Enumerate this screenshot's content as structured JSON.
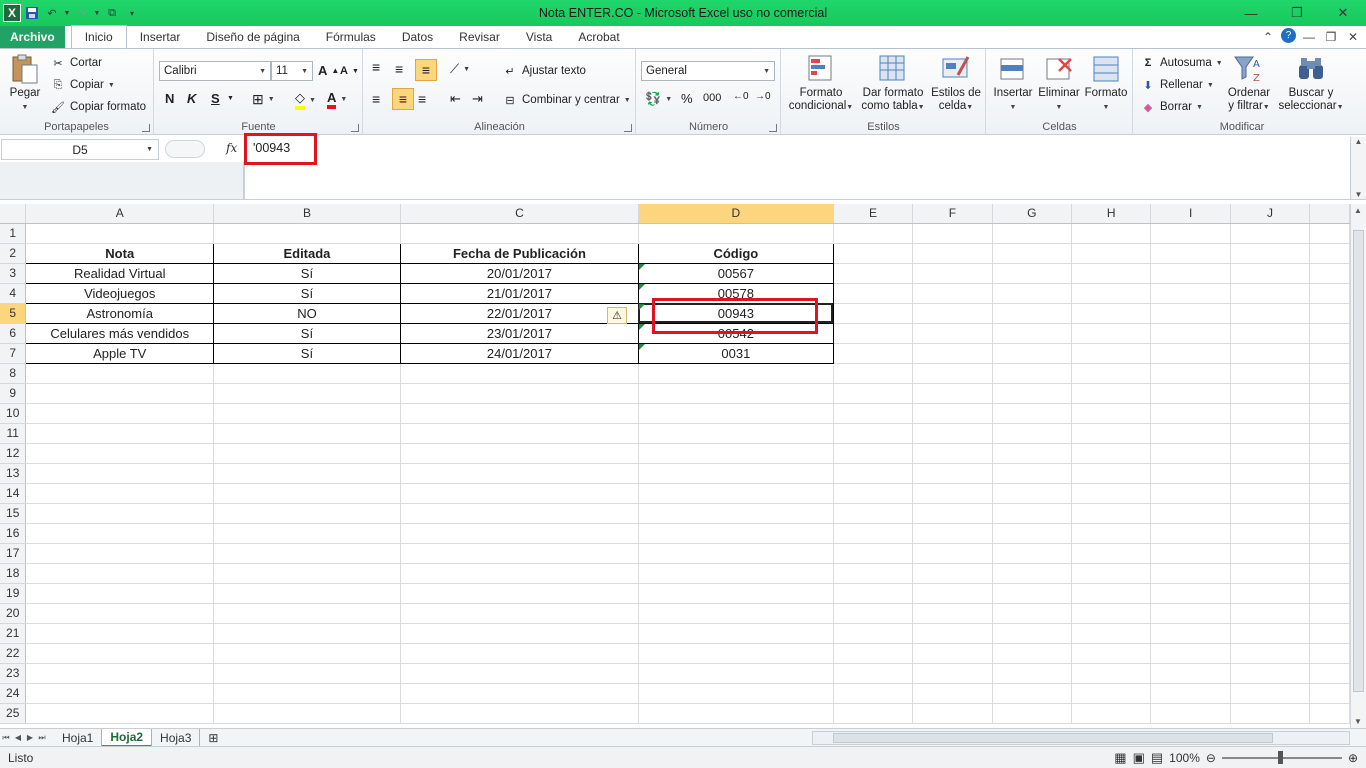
{
  "window": {
    "title": "Nota ENTER.CO  -  Microsoft Excel uso no comercial",
    "excel_green": "#21a366"
  },
  "tabs": [
    {
      "label": "Archivo",
      "key": "archivo"
    },
    {
      "label": "Inicio",
      "key": "inicio"
    },
    {
      "label": "Insertar",
      "key": "insertar"
    },
    {
      "label": "Diseño de página",
      "key": "diseno"
    },
    {
      "label": "Fórmulas",
      "key": "formulas"
    },
    {
      "label": "Datos",
      "key": "datos"
    },
    {
      "label": "Revisar",
      "key": "revisar"
    },
    {
      "label": "Vista",
      "key": "vista"
    },
    {
      "label": "Acrobat",
      "key": "acrobat"
    }
  ],
  "ribbon": {
    "portapapeles": {
      "label": "Portapapeles",
      "pegar": "Pegar",
      "cortar": "Cortar",
      "copiar": "Copiar",
      "copiar_formato": "Copiar formato"
    },
    "fuente": {
      "label": "Fuente",
      "font_name": "Calibri",
      "font_size": "11",
      "bold": "N",
      "italic": "K",
      "underline": "S"
    },
    "alineacion": {
      "label": "Alineación",
      "ajustar": "Ajustar texto",
      "combinar": "Combinar y centrar"
    },
    "numero": {
      "label": "Número",
      "format": "General",
      "percent": "%",
      "thousands": "000"
    },
    "estilos": {
      "label": "Estilos",
      "formato_condicional_1": "Formato",
      "formato_condicional_2": "condicional",
      "dar_formato_1": "Dar formato",
      "dar_formato_2": "como tabla",
      "estilos_celda_1": "Estilos de",
      "estilos_celda_2": "celda"
    },
    "celdas": {
      "label": "Celdas",
      "insertar": "Insertar",
      "eliminar": "Eliminar",
      "formato": "Formato"
    },
    "modificar": {
      "label": "Modificar",
      "autosuma": "Autosuma",
      "rellenar": "Rellenar",
      "borrar": "Borrar",
      "ordenar_1": "Ordenar",
      "ordenar_2": "y filtrar",
      "buscar_1": "Buscar y",
      "buscar_2": "seleccionar"
    }
  },
  "formula_bar": {
    "name_box": "D5",
    "fx": "fx",
    "content": "'00943"
  },
  "columns": [
    "A",
    "B",
    "C",
    "D",
    "E",
    "F",
    "G",
    "H",
    "I",
    "J"
  ],
  "rows": [
    "1",
    "2",
    "3",
    "4",
    "5",
    "6",
    "7",
    "8",
    "9",
    "10",
    "11",
    "12",
    "13",
    "14",
    "15",
    "16",
    "17",
    "18",
    "19",
    "20",
    "21",
    "22",
    "23",
    "24",
    "25"
  ],
  "table": {
    "headers": [
      "Nota",
      "Editada",
      "Fecha de Publicación",
      "Código"
    ],
    "data": [
      [
        "Realidad Virtual",
        "Sí",
        "20/01/2017",
        "00567"
      ],
      [
        "Videojuegos",
        "Sí",
        "21/01/2017",
        "00578"
      ],
      [
        "Astronomía",
        "NO",
        "22/01/2017",
        "00943"
      ],
      [
        "Celulares más vendidos",
        "Sí",
        "23/01/2017",
        "00542"
      ],
      [
        "Apple TV",
        "Sí",
        "24/01/2017",
        "0031"
      ]
    ]
  },
  "sheets": [
    {
      "label": "Hoja1",
      "active": false
    },
    {
      "label": "Hoja2",
      "active": true
    },
    {
      "label": "Hoja3",
      "active": false
    }
  ],
  "status": {
    "text": "Listo",
    "zoom": "100%"
  },
  "highlight_color": "#e0141e"
}
